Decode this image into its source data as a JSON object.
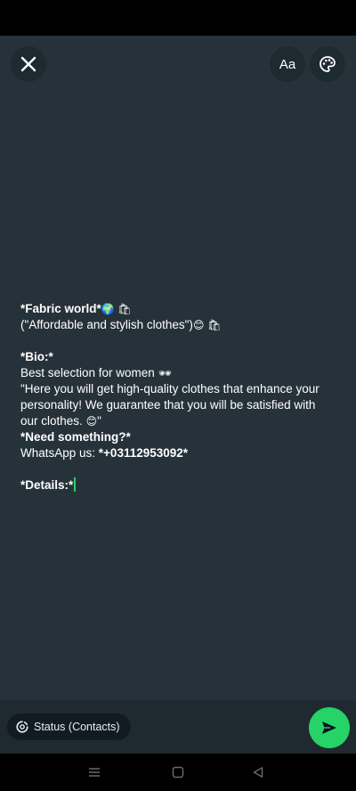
{
  "toolbar": {
    "close_icon": "close-icon",
    "font_label": "Aa",
    "palette_icon": "palette-icon"
  },
  "message": {
    "line1_title": "*Fabric world*",
    "line1_emoji": "🌍 🛍",
    "line2_text": "(\"Affordable and stylish clothes\")",
    "line2_emoji": "😊 🛍",
    "bio_heading": "*Bio:*",
    "bio_line1_text": "Best selection for women",
    "bio_line1_emoji": "🕶",
    "bio_quote_text": "\"Here you will get high-quality clothes that enhance your personality! We guarantee that you will be satisfied with our clothes.",
    "bio_quote_emoji": "😊",
    "bio_quote_end": "\"",
    "need_heading": "*Need something?*",
    "whatsapp_label": "WhatsApp us: ",
    "whatsapp_number": "*+03112953092*",
    "details_heading": "*Details:*"
  },
  "footer": {
    "audience_label": "Status (Contacts)",
    "send_icon": "send-icon"
  },
  "colors": {
    "canvas_bg": "#263239",
    "accent_green": "#25d366"
  }
}
